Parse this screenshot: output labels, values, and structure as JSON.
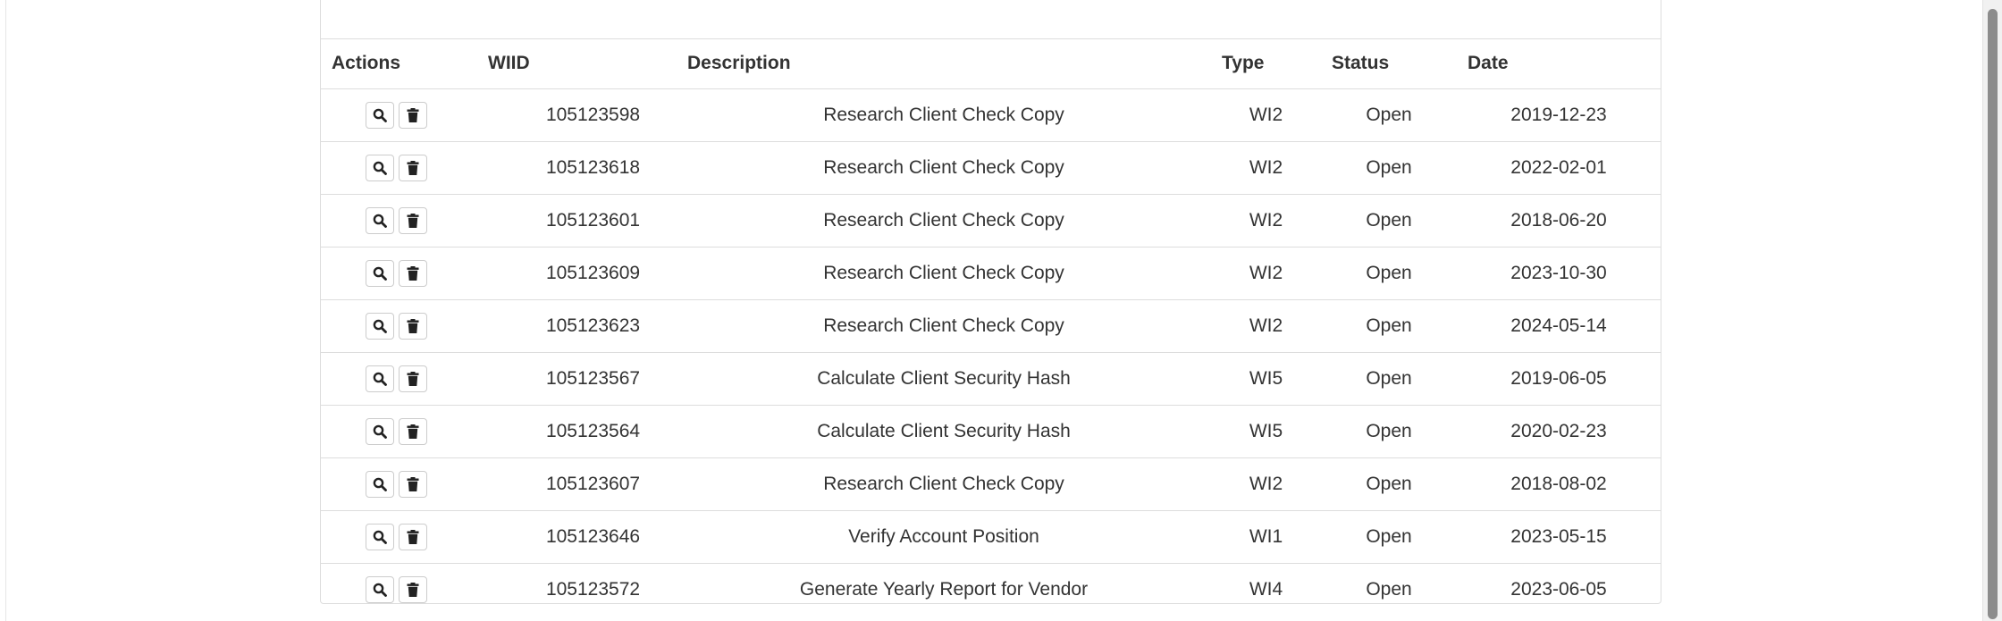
{
  "table": {
    "headers": {
      "actions": "Actions",
      "wiid": "WIID",
      "description": "Description",
      "type": "Type",
      "status": "Status",
      "date": "Date"
    },
    "rows": [
      {
        "wiid": "105123598",
        "description": "Research Client Check Copy",
        "type": "WI2",
        "status": "Open",
        "date": "2019-12-23"
      },
      {
        "wiid": "105123618",
        "description": "Research Client Check Copy",
        "type": "WI2",
        "status": "Open",
        "date": "2022-02-01"
      },
      {
        "wiid": "105123601",
        "description": "Research Client Check Copy",
        "type": "WI2",
        "status": "Open",
        "date": "2018-06-20"
      },
      {
        "wiid": "105123609",
        "description": "Research Client Check Copy",
        "type": "WI2",
        "status": "Open",
        "date": "2023-10-30"
      },
      {
        "wiid": "105123623",
        "description": "Research Client Check Copy",
        "type": "WI2",
        "status": "Open",
        "date": "2024-05-14"
      },
      {
        "wiid": "105123567",
        "description": "Calculate Client Security Hash",
        "type": "WI5",
        "status": "Open",
        "date": "2019-06-05"
      },
      {
        "wiid": "105123564",
        "description": "Calculate Client Security Hash",
        "type": "WI5",
        "status": "Open",
        "date": "2020-02-23"
      },
      {
        "wiid": "105123607",
        "description": "Research Client Check Copy",
        "type": "WI2",
        "status": "Open",
        "date": "2018-08-02"
      },
      {
        "wiid": "105123646",
        "description": "Verify Account Position",
        "type": "WI1",
        "status": "Open",
        "date": "2023-05-15"
      },
      {
        "wiid": "105123572",
        "description": "Generate Yearly Report for Vendor",
        "type": "WI4",
        "status": "Open",
        "date": "2023-06-05"
      }
    ],
    "row_action_icons": [
      "search-icon",
      "trash-icon"
    ]
  }
}
